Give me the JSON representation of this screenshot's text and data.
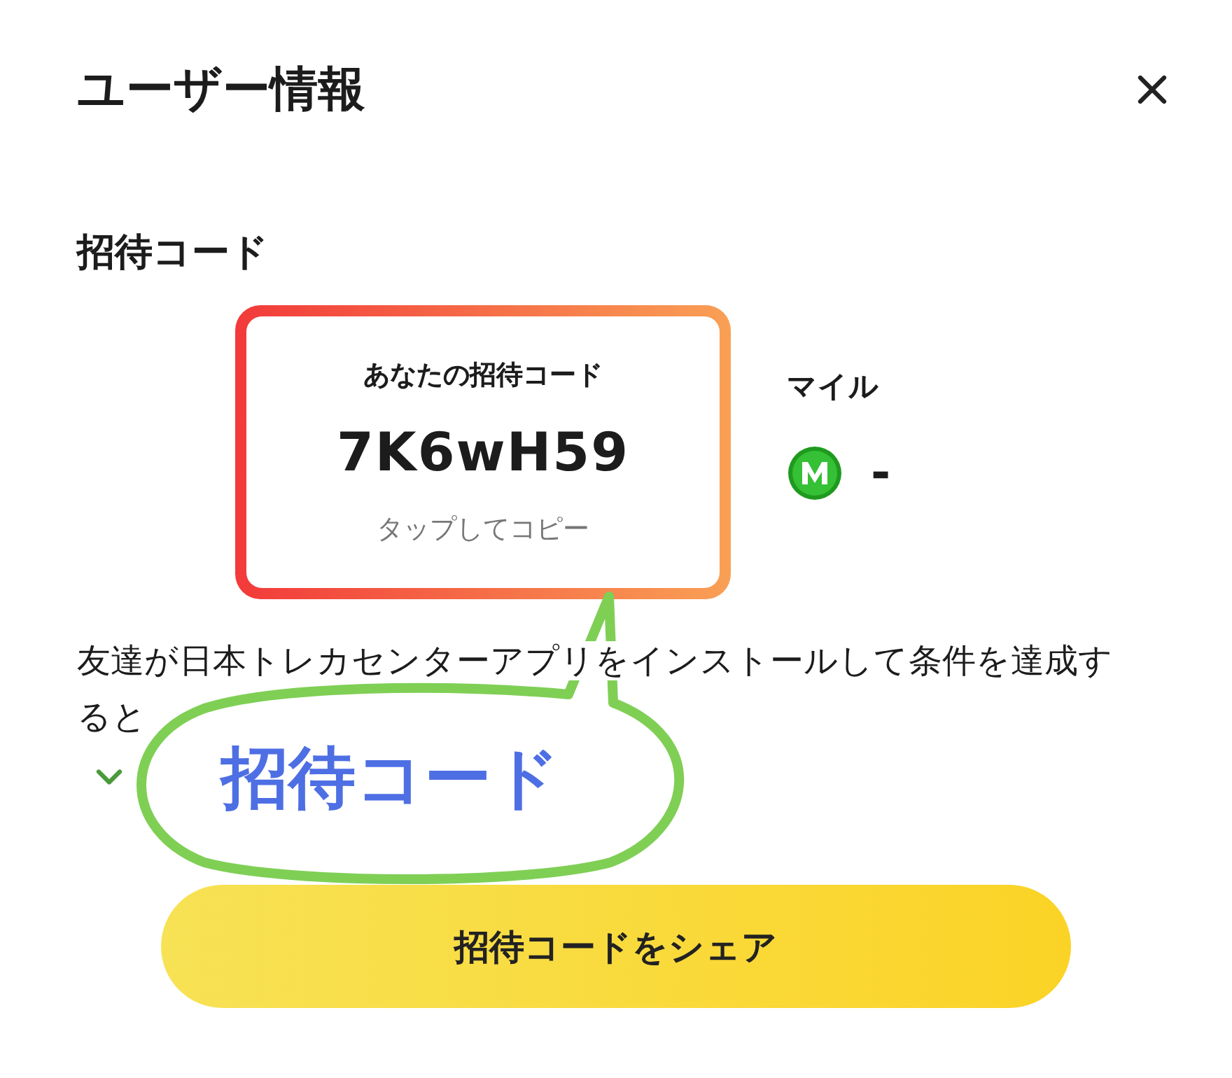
{
  "header": {
    "title": "ユーザー情報"
  },
  "section_title": "招待コード",
  "invite_card": {
    "label": "あなたの招待コード",
    "code": "7K6wH59",
    "hint": "タップしてコピー",
    "highlighted": true
  },
  "miles": {
    "label": "マイル",
    "value": "-"
  },
  "description": "友達が日本トレカセンターアプリをインストールして条件を達成すると",
  "details_toggle": {
    "expanded": false
  },
  "share_button": "招待コードをシェア",
  "callout": {
    "text": "招待コード"
  }
}
